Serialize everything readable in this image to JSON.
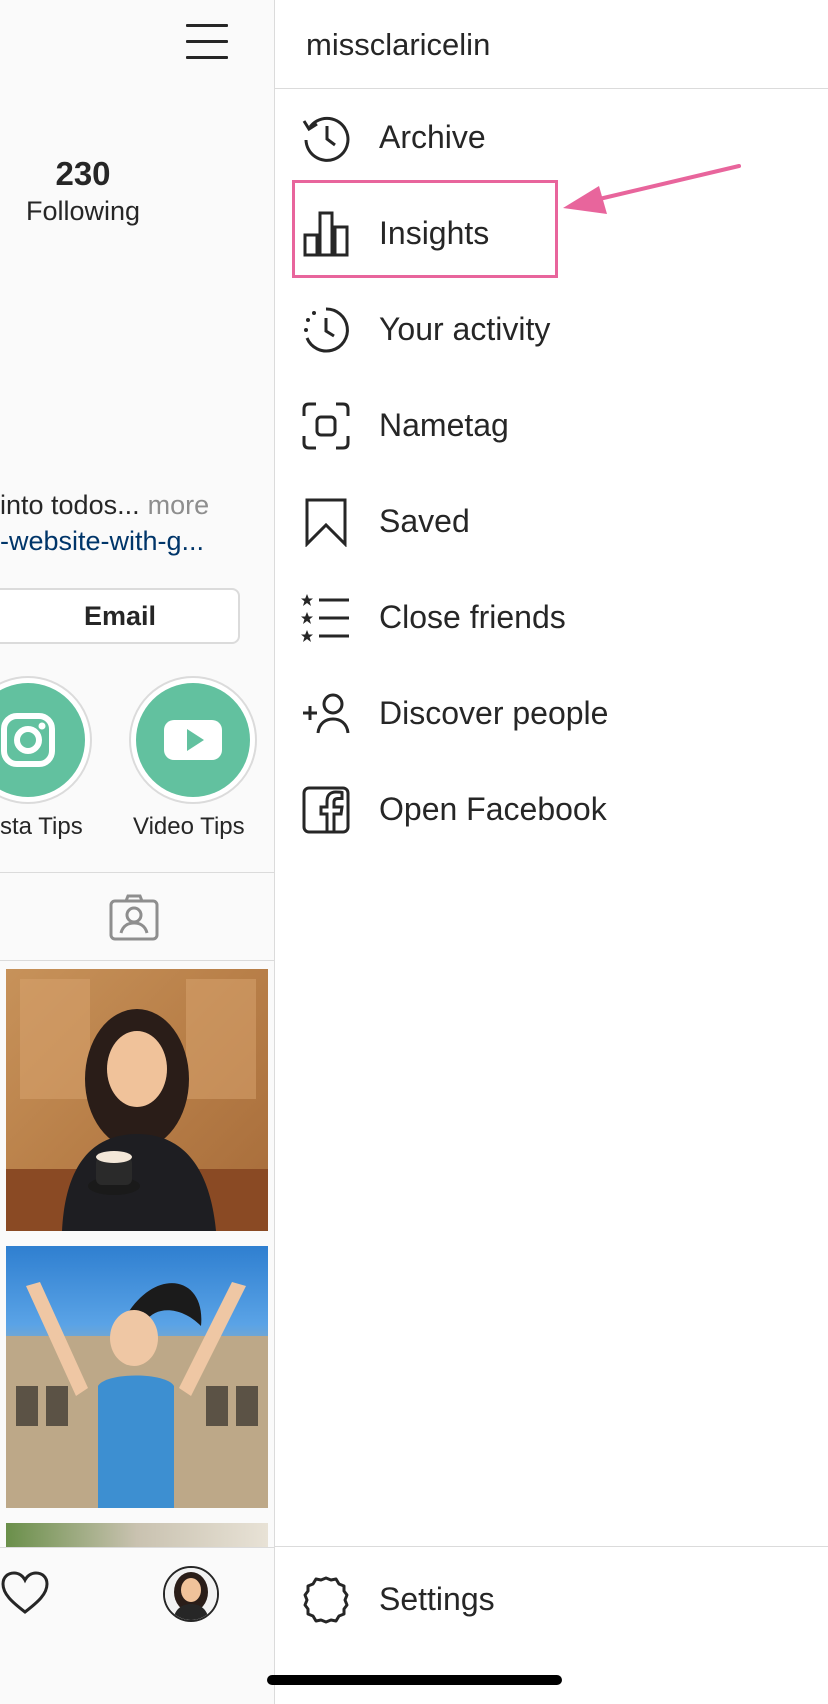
{
  "profile": {
    "following_count": "230",
    "following_label": "Following",
    "bio_text": "into todos...",
    "bio_more": "more",
    "bio_link": "-website-with-g...",
    "email_button": "Email",
    "highlights": [
      {
        "label": "sta Tips",
        "icon": "instagram-icon"
      },
      {
        "label": "Video Tips",
        "icon": "youtube-icon"
      }
    ],
    "highlight_color": "#62c19f",
    "link_color": "#003569"
  },
  "drawer": {
    "username": "missclaricelin",
    "items": [
      {
        "label": "Archive",
        "icon": "archive-clock-icon"
      },
      {
        "label": "Insights",
        "icon": "insights-bar-chart-icon"
      },
      {
        "label": "Your activity",
        "icon": "activity-clock-icon"
      },
      {
        "label": "Nametag",
        "icon": "nametag-scan-icon"
      },
      {
        "label": "Saved",
        "icon": "bookmark-icon"
      },
      {
        "label": "Close friends",
        "icon": "close-friends-list-icon"
      },
      {
        "label": "Discover people",
        "icon": "add-person-icon"
      },
      {
        "label": "Open Facebook",
        "icon": "facebook-icon"
      }
    ],
    "settings_label": "Settings",
    "settings_icon": "gear-icon",
    "annotation_color": "#e8659c"
  }
}
